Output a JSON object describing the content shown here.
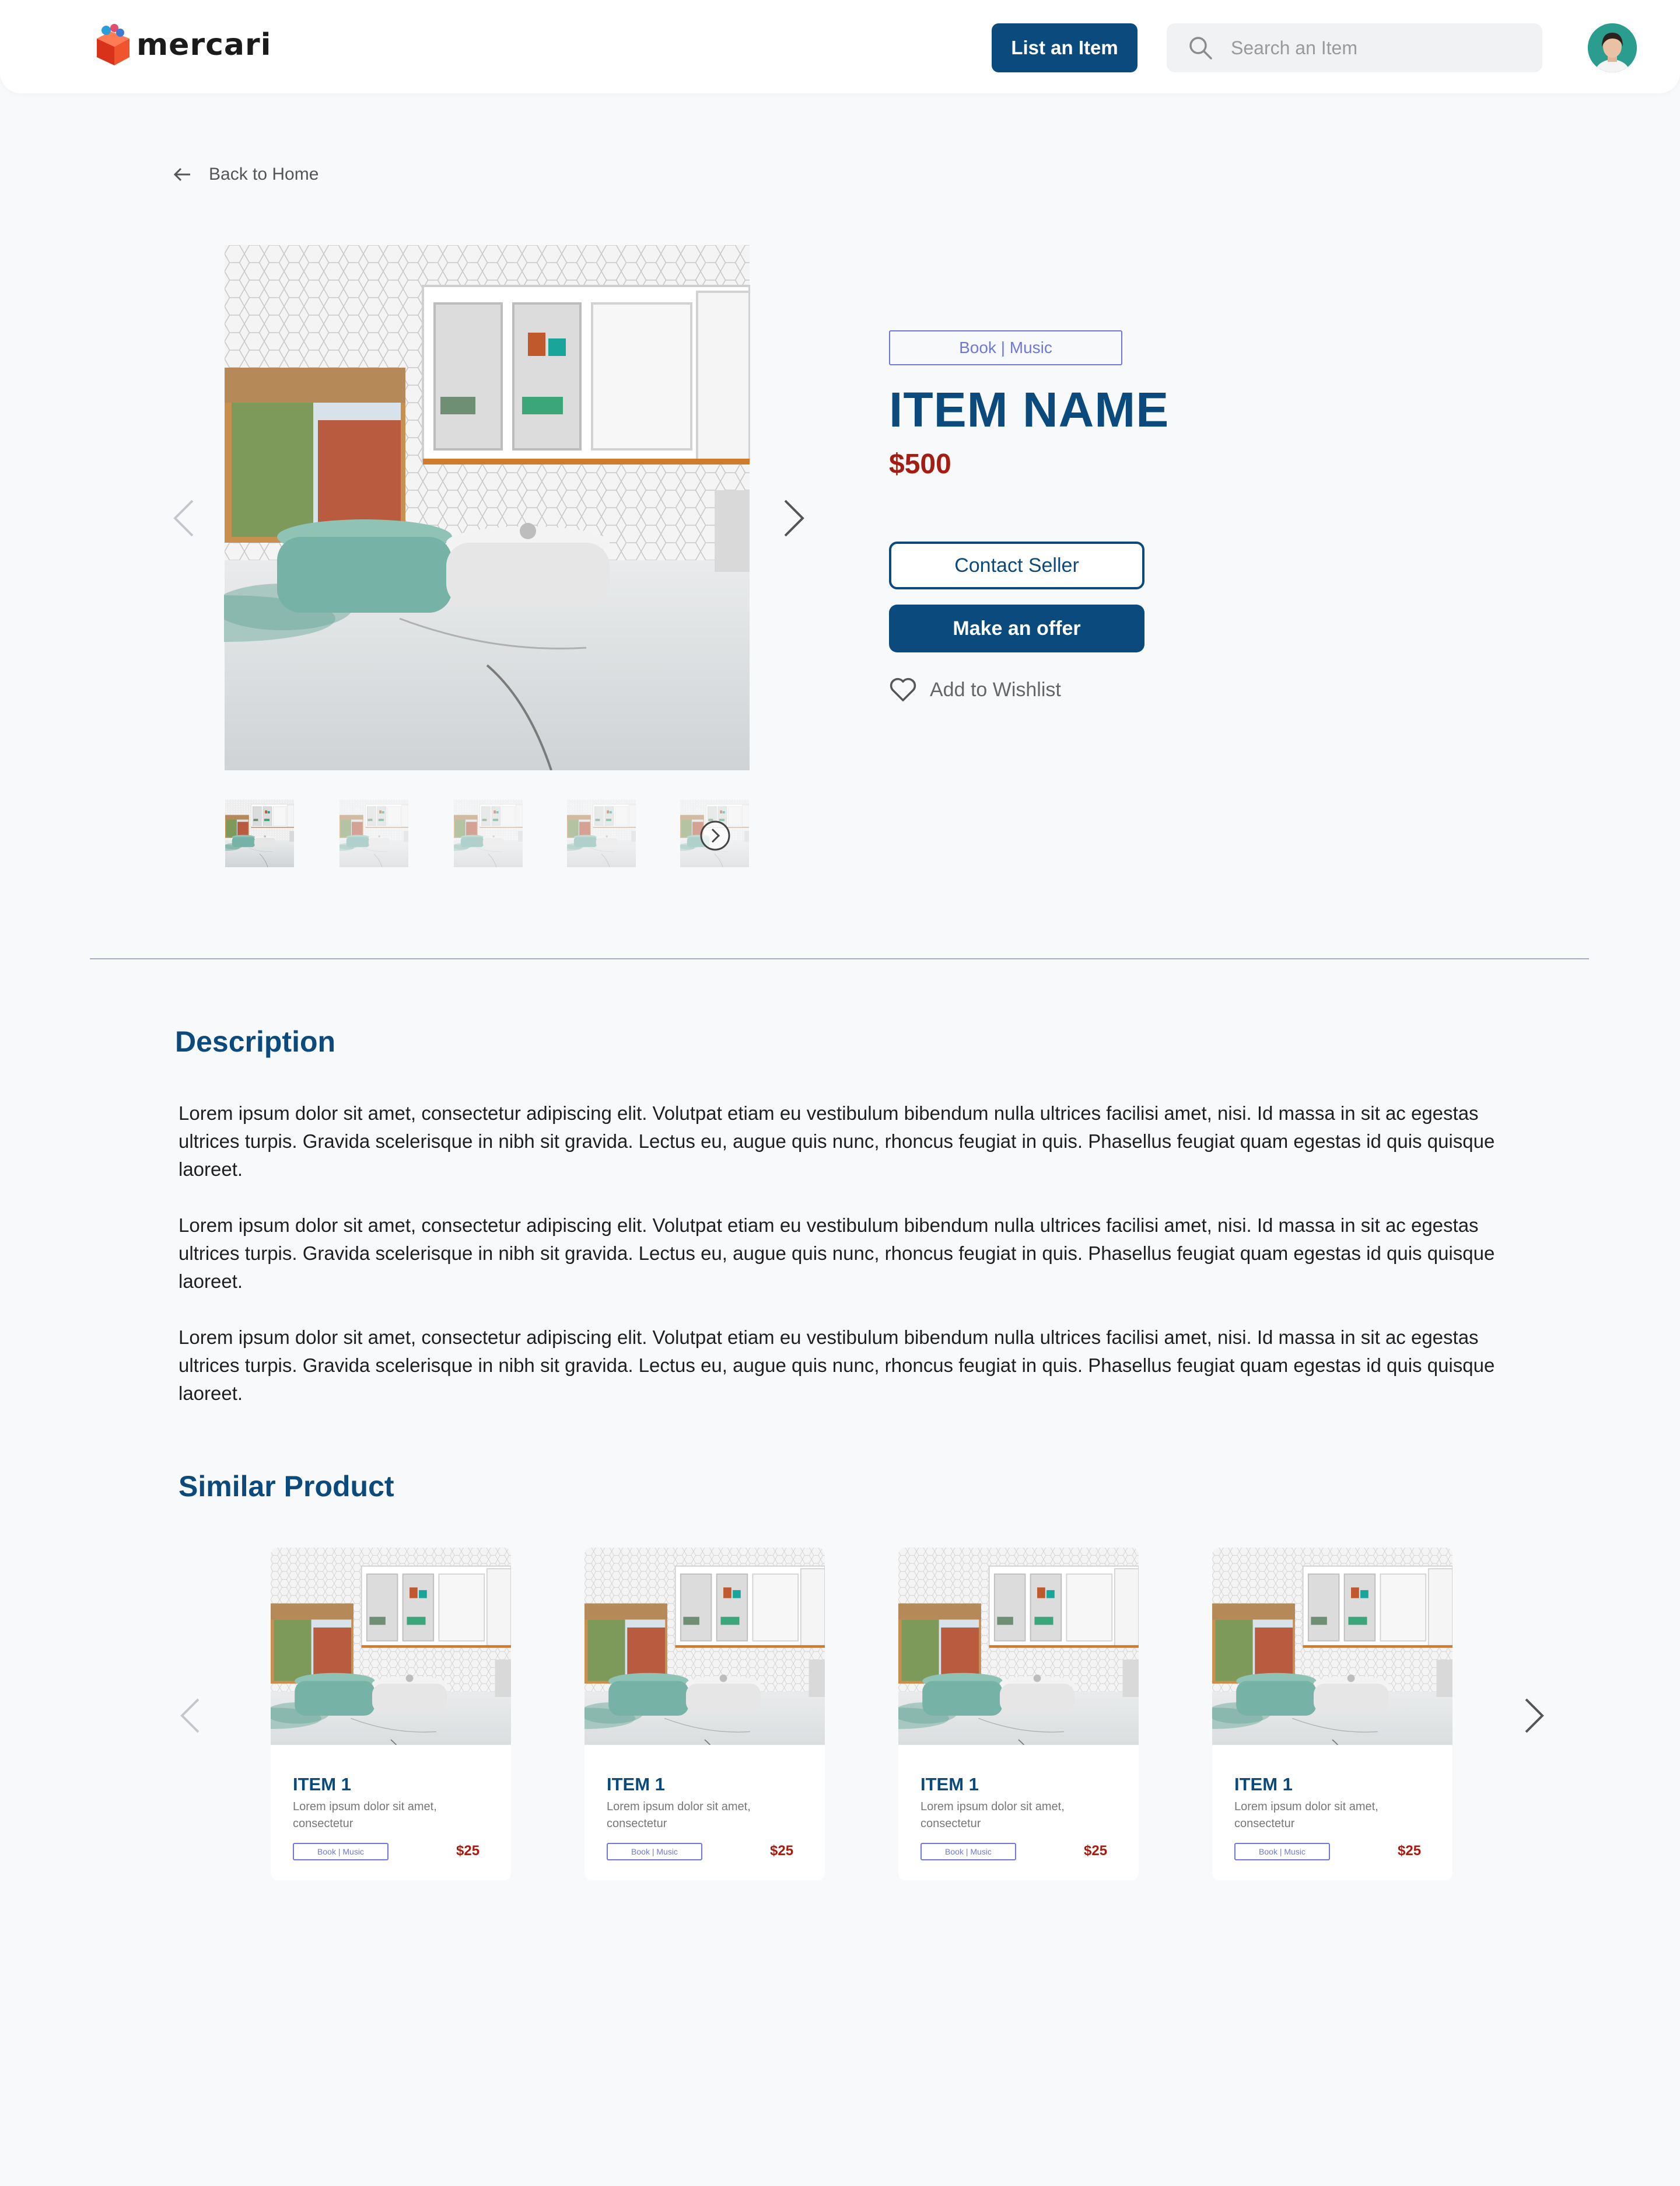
{
  "header": {
    "logo_text": "mercari",
    "list_button_label": "List an Item",
    "search_placeholder": "Search an Item"
  },
  "nav": {
    "back_label": "Back to Home"
  },
  "item": {
    "category": "Book | Music",
    "name": "ITEM NAME",
    "price": "$500",
    "contact_label": "Contact Seller",
    "offer_label": "Make an offer",
    "wishlist_label": "Add to Wishlist"
  },
  "description": {
    "title": "Description",
    "paragraphs": [
      "Lorem ipsum dolor sit amet, consectetur adipiscing elit. Volutpat etiam eu vestibulum bibendum nulla ultrices facilisi amet, nisi. Id massa in sit ac egestas ultrices turpis. Gravida scelerisque in nibh sit gravida. Lectus eu, augue quis nunc, rhoncus feugiat in quis. Phasellus feugiat quam egestas id quis quisque laoreet.",
      "Lorem ipsum dolor sit amet, consectetur adipiscing elit. Volutpat etiam eu vestibulum bibendum nulla ultrices facilisi amet, nisi. Id massa in sit ac egestas ultrices turpis. Gravida scelerisque in nibh sit gravida. Lectus eu, augue quis nunc, rhoncus feugiat in quis. Phasellus feugiat quam egestas id quis quisque laoreet.",
      "Lorem ipsum dolor sit amet, consectetur adipiscing elit. Volutpat etiam eu vestibulum bibendum nulla ultrices facilisi amet, nisi. Id massa in sit ac egestas ultrices turpis. Gravida scelerisque in nibh sit gravida. Lectus eu, augue quis nunc, rhoncus feugiat in quis. Phasellus feugiat quam egestas id quis quisque laoreet."
    ]
  },
  "similar": {
    "title": "Similar Product",
    "cards": [
      {
        "name": "ITEM 1",
        "desc": "Lorem ipsum dolor sit amet, consectetur",
        "tag": "Book | Music",
        "price": "$25"
      },
      {
        "name": "ITEM 1",
        "desc": "Lorem ipsum dolor sit amet, consectetur",
        "tag": "Book | Music",
        "price": "$25"
      },
      {
        "name": "ITEM 1",
        "desc": "Lorem ipsum dolor sit amet, consectetur",
        "tag": "Book | Music",
        "price": "$25"
      },
      {
        "name": "ITEM 1",
        "desc": "Lorem ipsum dolor sit amet, consectetur",
        "tag": "Book | Music",
        "price": "$25"
      }
    ]
  },
  "colors": {
    "brand_blue": "#0b4a7c",
    "price_red": "#a31d12",
    "tag_purple": "#6f78d8",
    "page_bg": "#f8f9fb"
  },
  "icons": [
    "mercari-logo-icon",
    "search-icon",
    "arrow-left-icon",
    "chevron-left-icon",
    "chevron-right-icon",
    "circle-chevron-right-icon",
    "heart-icon"
  ]
}
